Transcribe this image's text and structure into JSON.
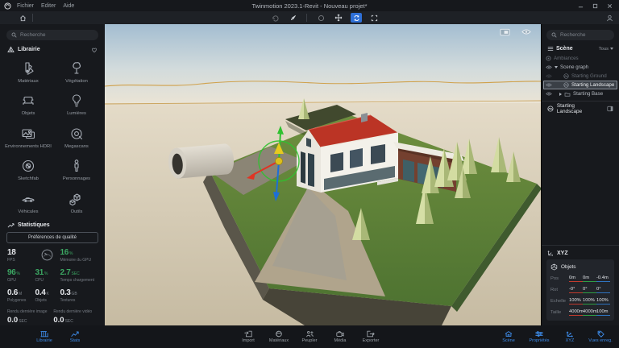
{
  "colors": {
    "accent-blue": "#3d8be8",
    "stat-green": "#3ca763"
  },
  "titlebar": {
    "menus": [
      {
        "label": "Fichier"
      },
      {
        "label": "Editer"
      },
      {
        "label": "Aide"
      }
    ],
    "title": "Twinmotion 2023.1-Revit - Nouveau projet*"
  },
  "left_sidebar": {
    "search_placeholder": "Recherche",
    "library": {
      "title": "Librairie",
      "items": [
        {
          "label": "Matériaux"
        },
        {
          "label": "Végétation"
        },
        {
          "label": "Objets"
        },
        {
          "label": "Lumières"
        },
        {
          "label": "Environnements HDRI"
        },
        {
          "label": "Megascans"
        },
        {
          "label": "Sketchfab"
        },
        {
          "label": "Personnages"
        },
        {
          "label": "Véhicules"
        },
        {
          "label": "Outils"
        }
      ]
    },
    "stats": {
      "title": "Statistiques",
      "quality_button": "Préférences de qualité",
      "metrics": [
        {
          "value": "18",
          "unit": "",
          "label": "FPS"
        },
        {
          "value": "16",
          "unit": "%",
          "label": "Mémoire du GPU"
        },
        {
          "value": "96",
          "unit": "%",
          "label": "GPU"
        },
        {
          "value": "31",
          "unit": "%",
          "label": "CPU"
        },
        {
          "value": "2.7",
          "unit": "SEC",
          "label": "Temps chargement"
        },
        {
          "value": "0.6",
          "unit": "M",
          "label": "Polygones"
        },
        {
          "value": "0.4",
          "unit": "K",
          "label": "Objets"
        },
        {
          "value": "0.3",
          "unit": "GB",
          "label": "Textures"
        }
      ],
      "renders": [
        {
          "label": "Rendu dernière image",
          "value": "0.0",
          "unit": "SEC"
        },
        {
          "label": "Rendu dernière vidéo",
          "value": "0.0",
          "unit": "SEC"
        }
      ]
    }
  },
  "right_sidebar": {
    "search_placeholder": "Recherche",
    "scene_panel": {
      "title": "Scène",
      "filter": "Tous",
      "tree": [
        {
          "label": "Ambiances"
        },
        {
          "label": "Scene graph"
        },
        {
          "label": "Starting Ground"
        },
        {
          "label": "Starting Landscape"
        },
        {
          "label": "Starting Base"
        }
      ],
      "selected_item": "Starting Landscape"
    },
    "xyz_panel": {
      "title": "XYZ",
      "target": "Objets",
      "rows": [
        {
          "label": "Pos",
          "values": [
            "0m",
            "0m",
            "-0.4m"
          ]
        },
        {
          "label": "Rot",
          "values": [
            "-0°",
            "0°",
            "0°"
          ]
        },
        {
          "label": "Echelle",
          "values": [
            "100%",
            "100%",
            "100%"
          ]
        },
        {
          "label": "Taille",
          "values": [
            "4000m",
            "4000m",
            "100m"
          ]
        }
      ]
    }
  },
  "dock": {
    "left": [
      {
        "label": "Librairie"
      },
      {
        "label": "Stats"
      }
    ],
    "center": [
      {
        "label": "Import"
      },
      {
        "label": "Matériaux"
      },
      {
        "label": "Peupler"
      },
      {
        "label": "Média"
      },
      {
        "label": "Exporter"
      }
    ],
    "right": [
      {
        "label": "Scène"
      },
      {
        "label": "Propriétés"
      },
      {
        "label": "XYZ"
      },
      {
        "label": "Vues enreg."
      }
    ]
  }
}
